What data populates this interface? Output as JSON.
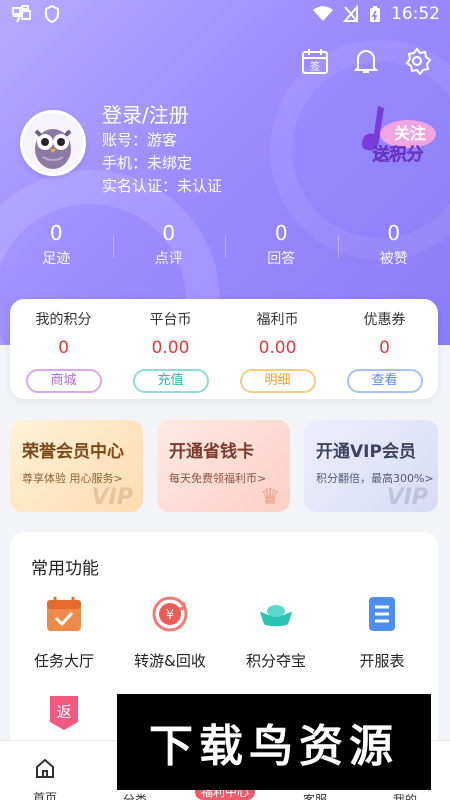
{
  "status_bar": {
    "time": "16:52"
  },
  "profile": {
    "title": "登录/注册",
    "account": "账号：游客",
    "phone": "手机：未绑定",
    "realname": "实名认证：未认证"
  },
  "badge": {
    "line1": "关注",
    "line2": "送积分"
  },
  "sign_label": "签",
  "stats": [
    {
      "value": "0",
      "label": "足迹"
    },
    {
      "value": "0",
      "label": "点评"
    },
    {
      "value": "0",
      "label": "回答"
    },
    {
      "value": "0",
      "label": "被赞"
    }
  ],
  "wallet": [
    {
      "label": "我的积分",
      "value": "0",
      "action": "商城",
      "color": "#b56be0"
    },
    {
      "label": "平台币",
      "value": "0.00",
      "action": "充值",
      "color": "#2ab7b0"
    },
    {
      "label": "福利币",
      "value": "0.00",
      "action": "明细",
      "color": "#f3a21f"
    },
    {
      "label": "优惠券",
      "value": "0",
      "action": "查看",
      "color": "#5a88e8"
    }
  ],
  "promo_cards": [
    {
      "title": "荣誉会员中心",
      "subtitle": "尊享体验 用心服务>",
      "deco": "VIP",
      "color": "#7b4a16",
      "bg": "#fde8c7"
    },
    {
      "title": "开通省钱卡",
      "subtitle": "每天免费领福利币>",
      "deco": "♛",
      "color": "#7b3a2c",
      "bg": "#fde0d8"
    },
    {
      "title": "开通VIP会员",
      "subtitle": "积分翻倍，最高300%>",
      "deco": "VIP",
      "color": "#3c4262",
      "bg": "#e6e7fb"
    }
  ],
  "functions": {
    "title": "常用功能",
    "items": [
      {
        "label": "任务大厅"
      },
      {
        "label": "转游&回收"
      },
      {
        "label": "积分夺宝"
      },
      {
        "label": "开服表"
      },
      {
        "label": "返"
      }
    ]
  },
  "tabbar": [
    {
      "label": "首页"
    },
    {
      "label": "分类"
    },
    {
      "label": "福利中心"
    },
    {
      "label": "客服"
    },
    {
      "label": "我的"
    }
  ],
  "watermark": "下载鸟资源"
}
